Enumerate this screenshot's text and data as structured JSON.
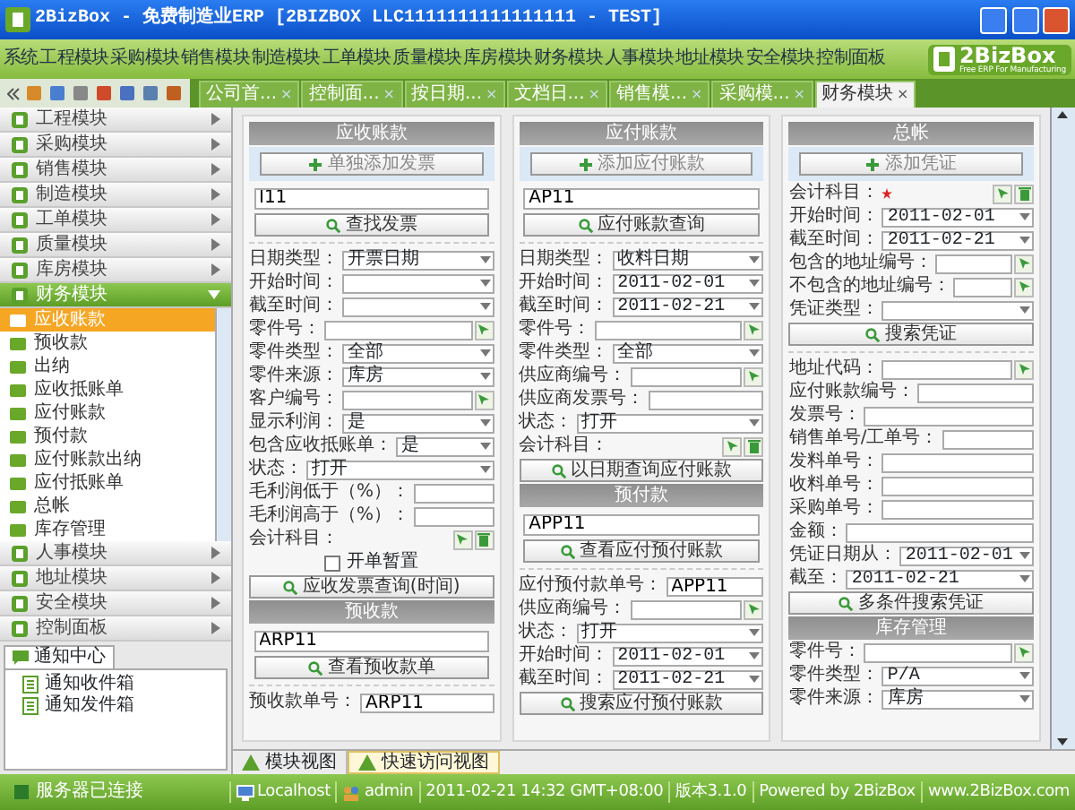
{
  "window": {
    "title": "2BizBox - 免费制造业ERP [2BIZBOX LLC1111111111111111 - TEST]"
  },
  "menu": [
    "系统",
    "工程模块",
    "采购模块",
    "销售模块",
    "制造模块",
    "工单模块",
    "质量模块",
    "库房模块",
    "财务模块",
    "人事模块",
    "地址模块",
    "安全模块",
    "控制面板"
  ],
  "logo": {
    "name": "2BizBox",
    "tagline": "Free ERP For Manufacturing"
  },
  "tabs": [
    {
      "label": "公司首...",
      "close": "×",
      "selected": false
    },
    {
      "label": "控制面...",
      "close": "×",
      "selected": false
    },
    {
      "label": "按日期...",
      "close": "×",
      "selected": false
    },
    {
      "label": "文档日...",
      "close": "×",
      "selected": false
    },
    {
      "label": "销售模...",
      "close": "×",
      "selected": false
    },
    {
      "label": "采购模...",
      "close": "×",
      "selected": false
    },
    {
      "label": "财务模块",
      "close": "×",
      "selected": true
    }
  ],
  "sidebar": {
    "modules": [
      {
        "label": "工程模块",
        "expanded": false
      },
      {
        "label": "采购模块",
        "expanded": false
      },
      {
        "label": "销售模块",
        "expanded": false
      },
      {
        "label": "制造模块",
        "expanded": false
      },
      {
        "label": "工单模块",
        "expanded": false
      },
      {
        "label": "质量模块",
        "expanded": false
      },
      {
        "label": "库房模块",
        "expanded": false
      },
      {
        "label": "财务模块",
        "expanded": true,
        "children": [
          {
            "label": "应收账款",
            "selected": true
          },
          {
            "label": "预收款",
            "selected": false
          },
          {
            "label": "出纳",
            "selected": false
          },
          {
            "label": "应收抵账单",
            "selected": false
          },
          {
            "label": "应付账款",
            "selected": false
          },
          {
            "label": "预付款",
            "selected": false
          },
          {
            "label": "应付账款出纳",
            "selected": false
          },
          {
            "label": "应付抵账单",
            "selected": false
          },
          {
            "label": "总帐",
            "selected": false
          },
          {
            "label": "库存管理",
            "selected": false
          }
        ]
      },
      {
        "label": "人事模块",
        "expanded": false
      },
      {
        "label": "地址模块",
        "expanded": false
      },
      {
        "label": "安全模块",
        "expanded": false
      },
      {
        "label": "控制面板",
        "expanded": false
      }
    ]
  },
  "notice": {
    "tab": "通知中心",
    "items": [
      {
        "label": "通知收件箱"
      },
      {
        "label": "通知发件箱"
      }
    ]
  },
  "columns": [
    {
      "items": [
        {
          "kind": "header",
          "label": "应收账款"
        },
        {
          "kind": "add",
          "label": "单独添加发票"
        },
        {
          "kind": "search",
          "value": "I11",
          "button": "查找发票"
        },
        {
          "kind": "divider"
        },
        {
          "kind": "select",
          "label": "日期类型：",
          "value": "开票日期"
        },
        {
          "kind": "date",
          "label": "开始时间："
        },
        {
          "kind": "date",
          "label": "截至时间："
        },
        {
          "kind": "picker",
          "label": "零件号："
        },
        {
          "kind": "select",
          "label": "零件类型：",
          "value": "全部"
        },
        {
          "kind": "select",
          "label": "零件来源：",
          "value": "库房"
        },
        {
          "kind": "picker",
          "label": "客户编号："
        },
        {
          "kind": "select",
          "label": "显示利润：",
          "value": "是"
        },
        {
          "kind": "select",
          "label": "包含应收抵账单：",
          "value": "是"
        },
        {
          "kind": "select",
          "label": "状态：",
          "value": "打开"
        },
        {
          "kind": "text",
          "label": "毛利润低于（%）："
        },
        {
          "kind": "text",
          "label": "毛利润高于（%）："
        },
        {
          "kind": "icons",
          "label": "会计科目："
        },
        {
          "kind": "checkbox",
          "label": "开单暂置",
          "checked": false
        },
        {
          "kind": "button",
          "label": "应收发票查询(时间)"
        },
        {
          "kind": "header",
          "label": "预收款"
        },
        {
          "kind": "search",
          "value": "ARP11",
          "button": "查看预收款单"
        },
        {
          "kind": "divider"
        },
        {
          "kind": "text",
          "label": "预收款单号：",
          "value": "ARP11"
        }
      ]
    },
    {
      "items": [
        {
          "kind": "header",
          "label": "应付账款"
        },
        {
          "kind": "add",
          "label": "添加应付账款"
        },
        {
          "kind": "search",
          "value": "AP11",
          "button": "应付账款查询"
        },
        {
          "kind": "divider"
        },
        {
          "kind": "select",
          "label": "日期类型：",
          "value": "收料日期"
        },
        {
          "kind": "date",
          "label": "开始时间：",
          "value": "2011-02-01"
        },
        {
          "kind": "date",
          "label": "截至时间：",
          "value": "2011-02-21"
        },
        {
          "kind": "picker",
          "label": "零件号："
        },
        {
          "kind": "select",
          "label": "零件类型：",
          "value": "全部"
        },
        {
          "kind": "picker",
          "label": "供应商编号："
        },
        {
          "kind": "text",
          "label": "供应商发票号："
        },
        {
          "kind": "select",
          "label": "状态：",
          "value": "打开"
        },
        {
          "kind": "icons",
          "label": "会计科目："
        },
        {
          "kind": "button",
          "label": "以日期查询应付账款"
        },
        {
          "kind": "header",
          "label": "预付款"
        },
        {
          "kind": "search",
          "value": "APP11",
          "button": "查看应付预付账款"
        },
        {
          "kind": "divider"
        },
        {
          "kind": "text",
          "label": "应付预付款单号：",
          "value": "APP11"
        },
        {
          "kind": "picker",
          "label": "供应商编号："
        },
        {
          "kind": "select",
          "label": "状态：",
          "value": "打开"
        },
        {
          "kind": "date",
          "label": "开始时间：",
          "value": "2011-02-01"
        },
        {
          "kind": "date",
          "label": "截至时间：",
          "value": "2011-02-21"
        },
        {
          "kind": "button",
          "label": "搜索应付预付账款"
        }
      ]
    },
    {
      "items": [
        {
          "kind": "header",
          "label": "总帐"
        },
        {
          "kind": "add",
          "label": "添加凭证"
        },
        {
          "kind": "icons",
          "label": "会计科目：",
          "required": true
        },
        {
          "kind": "date",
          "label": "开始时间：",
          "value": "2011-02-01"
        },
        {
          "kind": "date",
          "label": "截至时间：",
          "value": "2011-02-21"
        },
        {
          "kind": "picker",
          "label": "包含的地址编号："
        },
        {
          "kind": "picker",
          "label": "不包含的地址编号："
        },
        {
          "kind": "select",
          "label": "凭证类型："
        },
        {
          "kind": "button",
          "label": "搜索凭证"
        },
        {
          "kind": "divider"
        },
        {
          "kind": "picker",
          "label": "地址代码："
        },
        {
          "kind": "text",
          "label": "应付账款编号："
        },
        {
          "kind": "text",
          "label": "发票号："
        },
        {
          "kind": "text",
          "label": "销售单号/工单号："
        },
        {
          "kind": "text",
          "label": "发料单号："
        },
        {
          "kind": "text",
          "label": "收料单号："
        },
        {
          "kind": "text",
          "label": "采购单号："
        },
        {
          "kind": "text",
          "label": "金额："
        },
        {
          "kind": "date",
          "label": "凭证日期从：",
          "value": "2011-02-01"
        },
        {
          "kind": "date",
          "label": "截至：",
          "value": "2011-02-21"
        },
        {
          "kind": "button",
          "label": "多条件搜索凭证"
        },
        {
          "kind": "header",
          "label": "库存管理"
        },
        {
          "kind": "picker",
          "label": "零件号："
        },
        {
          "kind": "select",
          "label": "零件类型：",
          "value": "P/A"
        },
        {
          "kind": "select",
          "label": "零件来源：",
          "value": "库房"
        }
      ]
    }
  ],
  "view_tabs": [
    {
      "label": "模块视图",
      "selected": false
    },
    {
      "label": "快速访问视图",
      "selected": true
    }
  ],
  "status_bar": {
    "left": "服务器已连接",
    "items": [
      {
        "kind": "host",
        "text": "Localhost"
      },
      {
        "kind": "user",
        "text": "admin"
      },
      {
        "kind": "plain",
        "text": "2011-02-21 14:32 GMT+08:00"
      },
      {
        "kind": "plain",
        "text": "版本3.1.0"
      },
      {
        "kind": "plain",
        "text": "Powered by 2BizBox"
      },
      {
        "kind": "plain",
        "text": "www.2BizBox.com"
      }
    ]
  }
}
